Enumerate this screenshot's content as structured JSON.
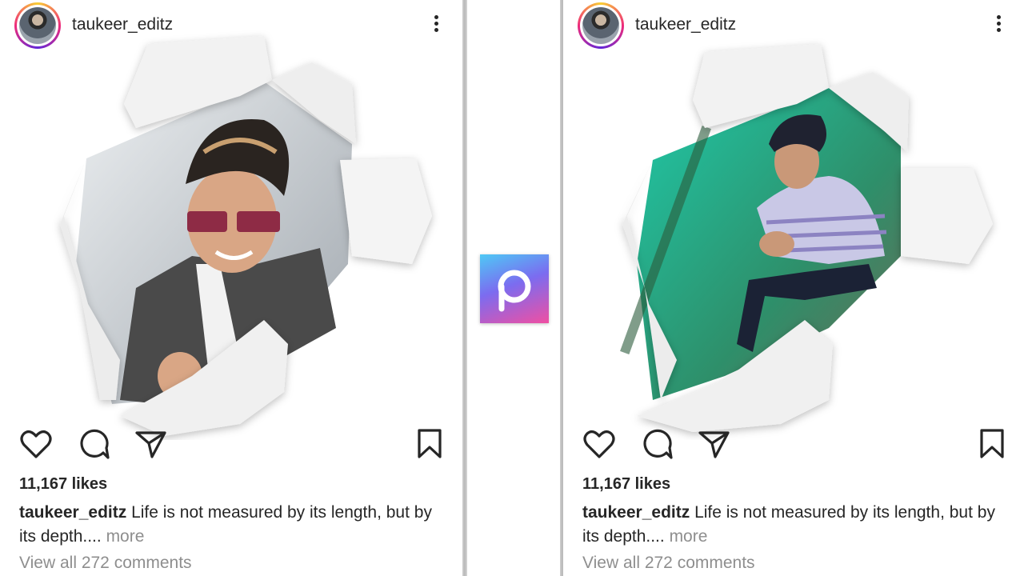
{
  "posts": [
    {
      "username": "taukeer_editz",
      "likes": "11,167 likes",
      "caption_user": "taukeer_editz",
      "caption_text": " Life is not measured by its length, but by its depth....",
      "caption_more": " more",
      "comments": "View all 272 comments"
    },
    {
      "username": "taukeer_editz",
      "likes": "11,167 likes",
      "caption_user": "taukeer_editz",
      "caption_text": " Life is not measured by its length, but by its depth....",
      "caption_more": " more",
      "comments": "View all 272 comments"
    }
  ],
  "icons": {
    "like": "heart-icon",
    "comment": "comment-icon",
    "share": "send-icon",
    "save": "bookmark-icon",
    "options": "more-vertical-icon",
    "app_logo": "picsart-logo"
  },
  "colors": {
    "text": "#262626",
    "muted": "#8e8e8e",
    "logo_start": "#4ec9f5",
    "logo_end": "#f04fa2"
  }
}
